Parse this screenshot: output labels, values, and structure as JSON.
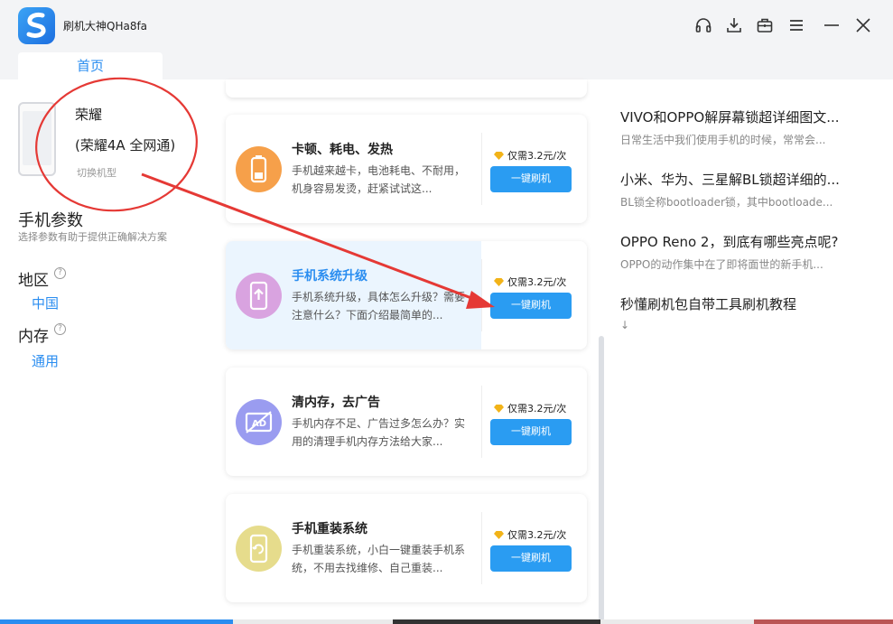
{
  "app": {
    "title": "刷机大神QHa8fa"
  },
  "tabs": [
    {
      "label": "首页"
    }
  ],
  "window_controls": [
    "headset-icon",
    "download-icon",
    "toolbox-icon",
    "menu-icon",
    "minimize-icon",
    "close-icon"
  ],
  "device": {
    "brand": "荣耀",
    "model": "(荣耀4A 全网通)",
    "switch_label": "切换机型"
  },
  "params": {
    "title": "手机参数",
    "subtitle": "选择参数有助于提供正确解决方案",
    "region": {
      "label": "地区",
      "help": "?",
      "value": "中国"
    },
    "memory": {
      "label": "内存",
      "help": "?",
      "value": "通用"
    }
  },
  "services": [
    {
      "title": "卡顿、耗电、发热",
      "desc": "手机越来越卡，电池耗电、不耐用，机身容易发烫，赶紧试试这...",
      "price": "仅需3.2元/次",
      "button": "一键刷机",
      "icon": "battery-icon",
      "icon_color": "#f6a04a",
      "highlighted": false
    },
    {
      "title": "手机系统升级",
      "desc": "手机系统升级，具体怎么升级？需要注意什么？下面介绍最简单的...",
      "price": "仅需3.2元/次",
      "button": "一键刷机",
      "icon": "phone-upgrade-icon",
      "icon_color": "#d9a3e0",
      "highlighted": true
    },
    {
      "title": "清内存，去广告",
      "desc": "手机内存不足、广告过多怎么办？实用的清理手机内存方法给大家...",
      "price": "仅需3.2元/次",
      "button": "一键刷机",
      "icon": "ad-block-icon",
      "icon_color": "#9a9cf0",
      "highlighted": false
    },
    {
      "title": "手机重装系统",
      "desc": "手机重装系统，小白一键重装手机系统，不用去找维修、自己重装...",
      "price": "仅需3.2元/次",
      "button": "一键刷机",
      "icon": "reinstall-icon",
      "icon_color": "#e6dc8c",
      "highlighted": false
    }
  ],
  "articles": [
    {
      "title": "VIVO和OPPO解屏幕锁超详细图文...",
      "summary": "日常生活中我们使用手机的时候，常常会..."
    },
    {
      "title": "小米、华为、三星解BL锁超详细的...",
      "summary": "BL锁全称bootloader锁，其中bootloade..."
    },
    {
      "title": "OPPO Reno 2，到底有哪些亮点呢?",
      "summary": "OPPO的动作集中在了即将面世的新手机..."
    },
    {
      "title": "秒懂刷机包自带工具刷机教程",
      "summary": "↓"
    }
  ],
  "colors": {
    "accent": "#2a8df0",
    "button": "#2a9cf2",
    "annotation": "#e53935",
    "diamond": "#f2b318"
  }
}
